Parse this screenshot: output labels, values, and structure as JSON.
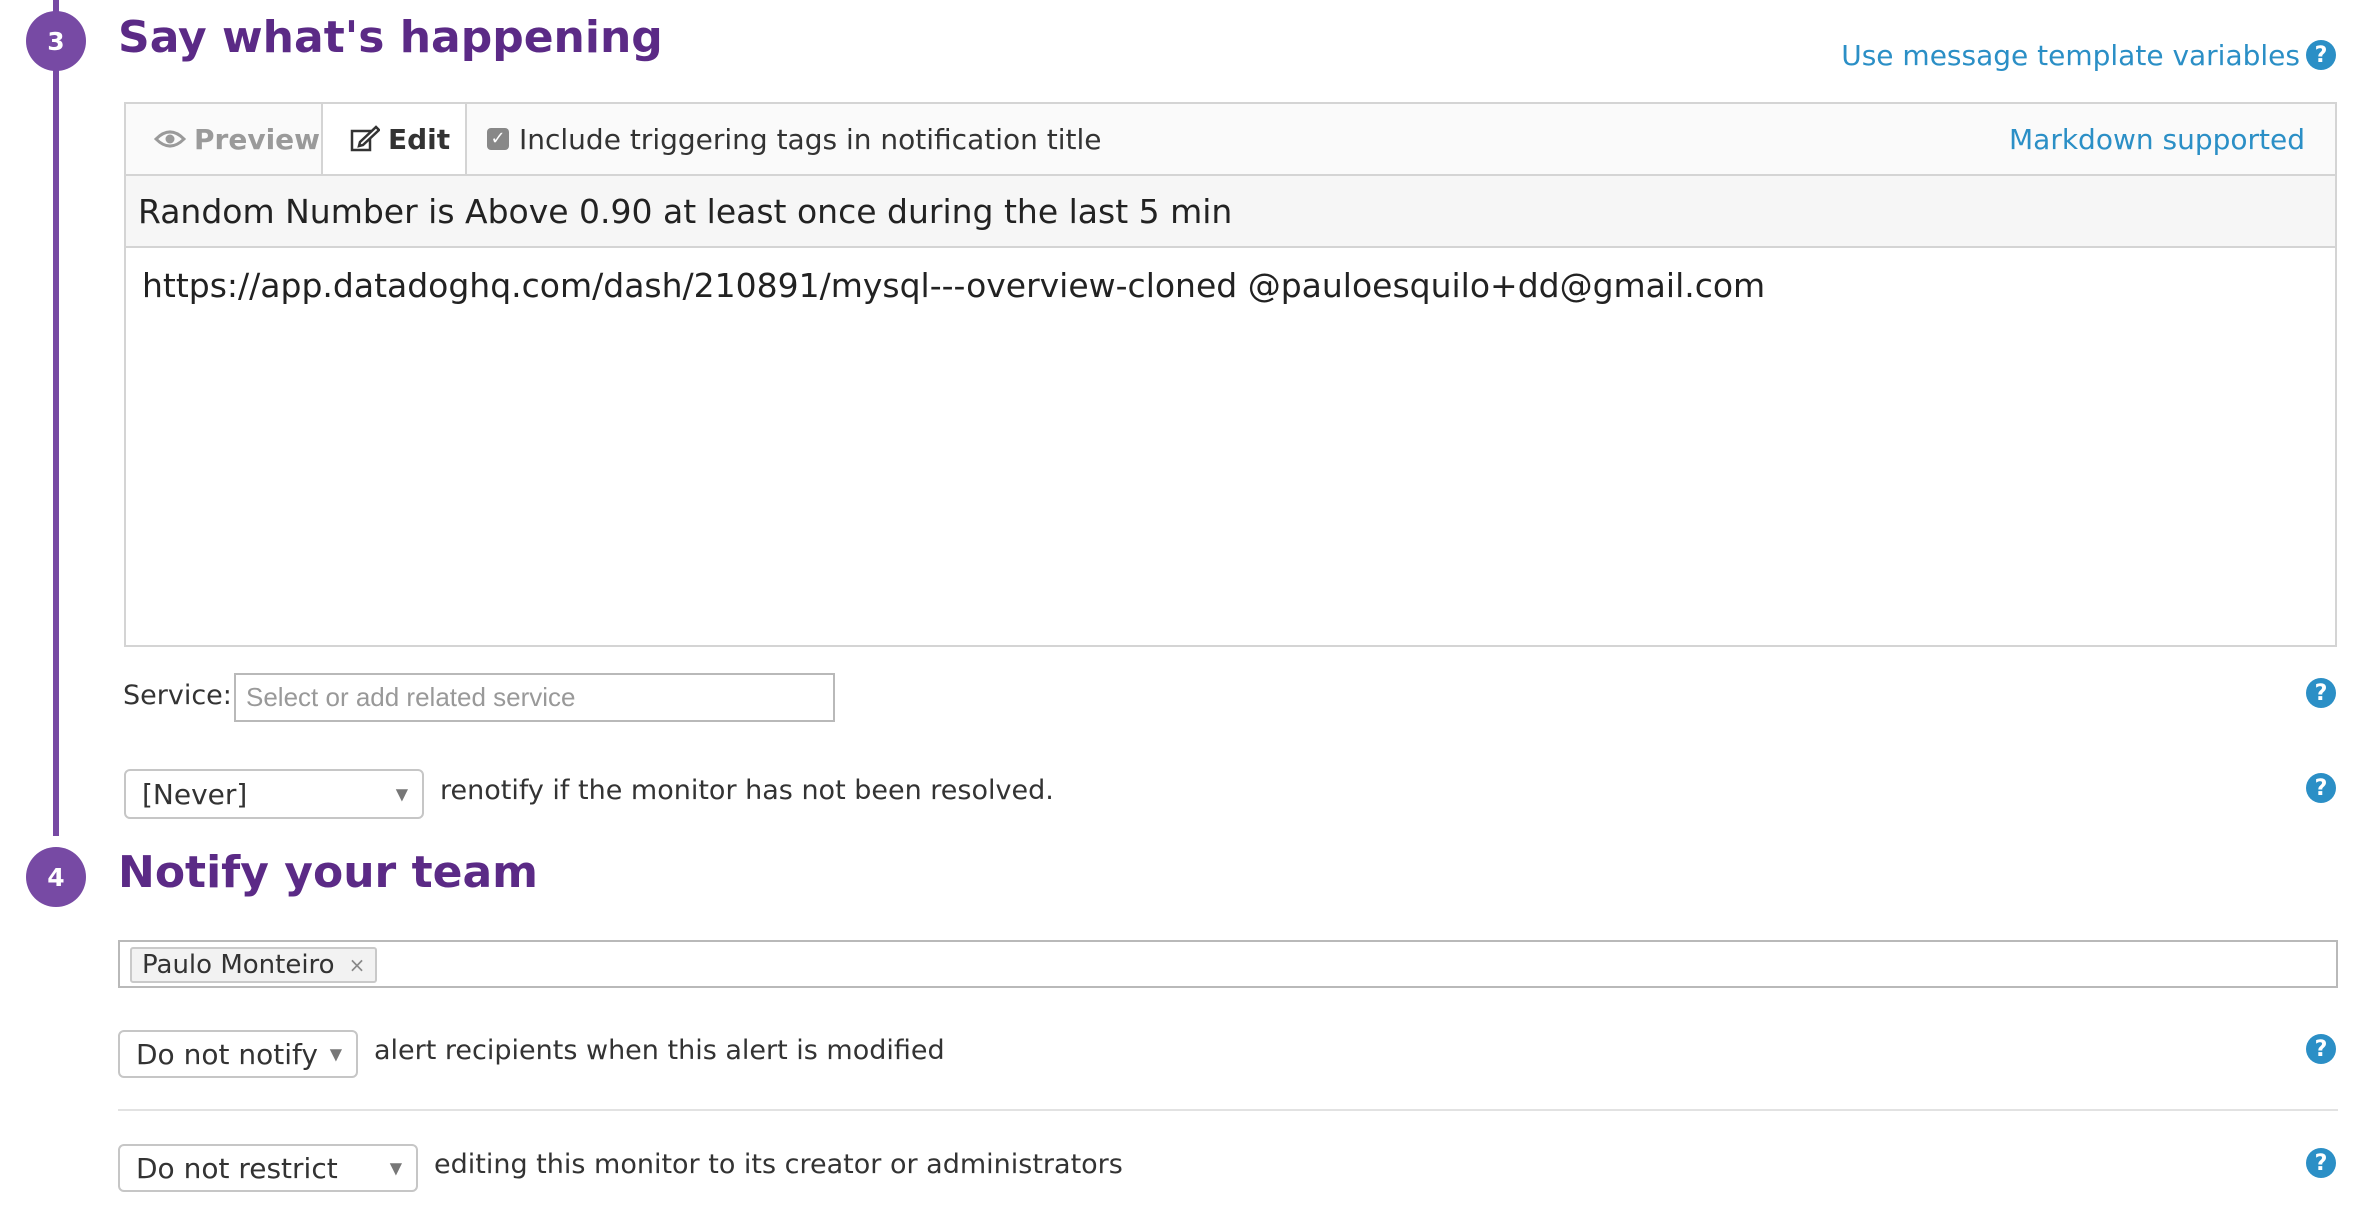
{
  "step3": {
    "number": "3",
    "title": "Say what's happening",
    "template_link": "Use message template variables",
    "help_glyph": "?",
    "editor": {
      "tab_preview": "Preview",
      "tab_edit": "Edit",
      "include_tags_label": "Include triggering tags in notification title",
      "include_tags_checked": true,
      "markdown_link": "Markdown supported",
      "title_value": "Random Number is Above 0.90 at least once during the last 5 min",
      "body_value": "https://app.datadoghq.com/dash/210891/mysql---overview-cloned @pauloesquilo+dd@gmail.com"
    },
    "service": {
      "label": "Service:",
      "placeholder": "Select or add related service"
    },
    "renotify": {
      "selected": "[Never]",
      "text": "renotify if the monitor has not been resolved."
    }
  },
  "step4": {
    "number": "4",
    "title": "Notify your team",
    "recipients": [
      "Paulo Monteiro"
    ],
    "remove_glyph": "×",
    "notify_modified": {
      "selected": "Do not notify",
      "text": "alert recipients when this alert is modified"
    },
    "restrict_editing": {
      "selected": "Do not restrict",
      "text": "editing this monitor to its creator or administrators"
    }
  },
  "colors": {
    "accent_purple": "#774aa4",
    "title_purple": "#5b2a86",
    "link_blue": "#2b8fc6"
  }
}
